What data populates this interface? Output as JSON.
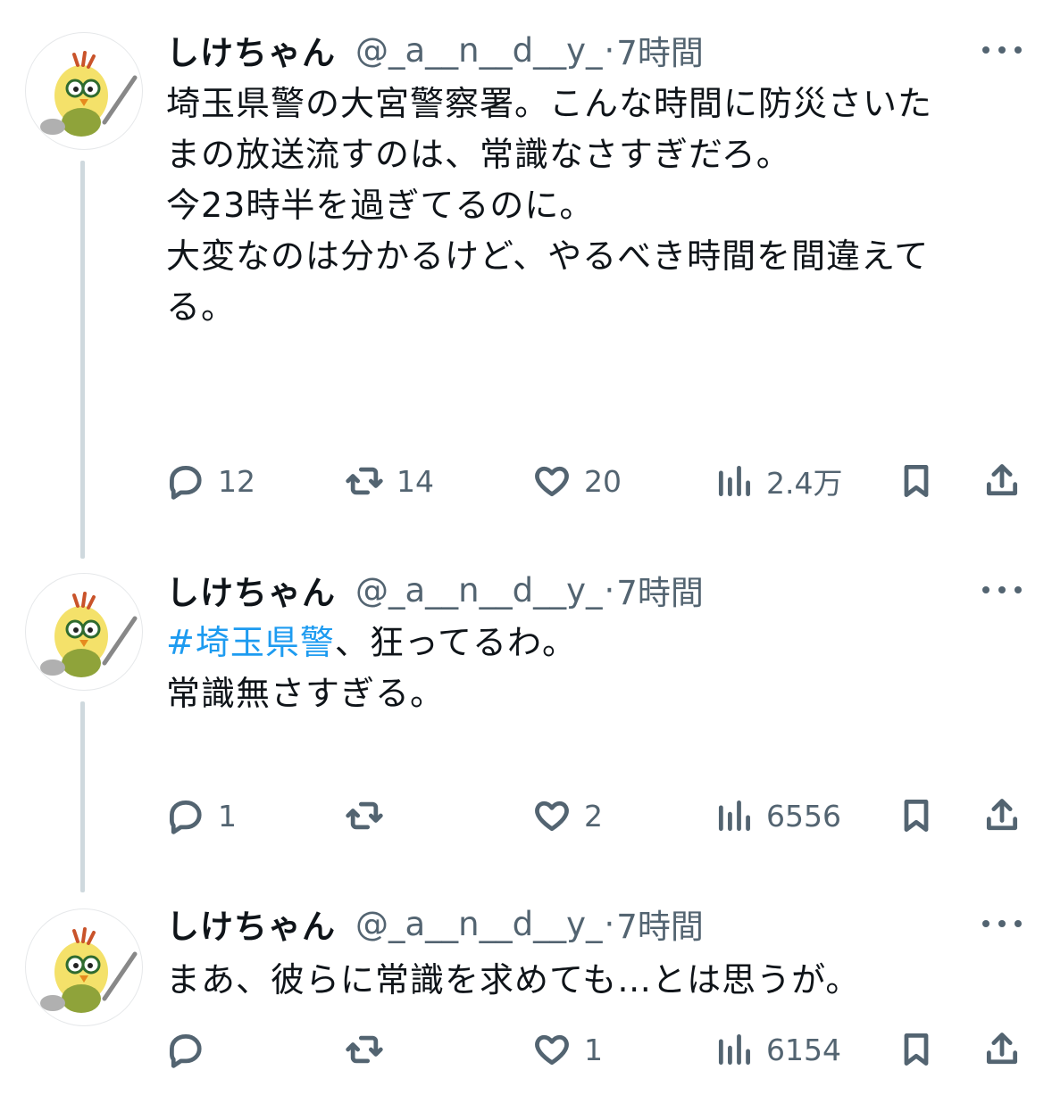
{
  "tweets": [
    {
      "name": "しけちゃん",
      "handle": "@_a__n__d__y_",
      "separator": "·",
      "time": "7時間",
      "text_lines": [
        "埼玉県警の大宮警察署。こんな時間に防災さいた",
        "まの放送流すのは、常識なさすぎだろ。",
        "",
        "今23時半を過ぎてるのに。",
        "",
        "大変なのは分かるけど、やるべき時間を間違えて",
        "る。"
      ],
      "replies": "12",
      "retweets": "14",
      "likes": "20",
      "views": "2.4万"
    },
    {
      "name": "しけちゃん",
      "handle": "@_a__n__d__y_",
      "separator": "·",
      "time": "7時間",
      "hashtag": "#埼玉県警",
      "text_after_hashtag": "、狂ってるわ。",
      "text_lines": [
        "",
        "常識無さすぎる。"
      ],
      "replies": "1",
      "retweets": "",
      "likes": "2",
      "views": "6556"
    },
    {
      "name": "しけちゃん",
      "handle": "@_a__n__d__y_",
      "separator": "·",
      "time": "7時間",
      "text_lines": [
        "まあ、彼らに常識を求めても…とは思うが。"
      ],
      "replies": "",
      "retweets": "",
      "likes": "1",
      "views": "6154"
    }
  ],
  "icons": [
    "reply-icon",
    "retweet-icon",
    "like-icon",
    "views-icon",
    "bookmark-icon",
    "share-icon",
    "more-icon",
    "avatar"
  ],
  "colors": {
    "hashtag": "#1d9bf0",
    "secondary_text": "#536471",
    "thread_line": "#cfd9de"
  }
}
